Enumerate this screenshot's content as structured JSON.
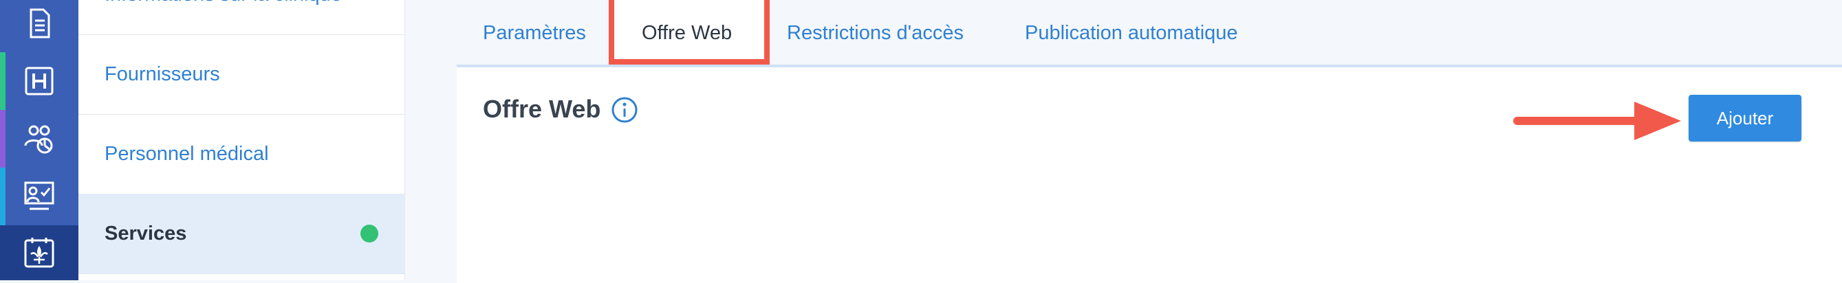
{
  "sidebar": {
    "items": [
      {
        "label": "Informations sur la clinique"
      },
      {
        "label": "Fournisseurs"
      },
      {
        "label": "Personnel médical"
      },
      {
        "label": "Services",
        "status": "active"
      }
    ]
  },
  "tabs": [
    {
      "label": "Paramètres"
    },
    {
      "label": "Offre Web"
    },
    {
      "label": "Restrictions d'accès"
    },
    {
      "label": "Publication automatique"
    }
  ],
  "panel": {
    "title": "Offre Web",
    "add_button": "Ajouter"
  },
  "colors": {
    "rail": "#3b5fb5",
    "link": "#2f80d1",
    "highlight": "#f15a4a",
    "button": "#2f8ae0",
    "status_dot": "#33c173"
  }
}
